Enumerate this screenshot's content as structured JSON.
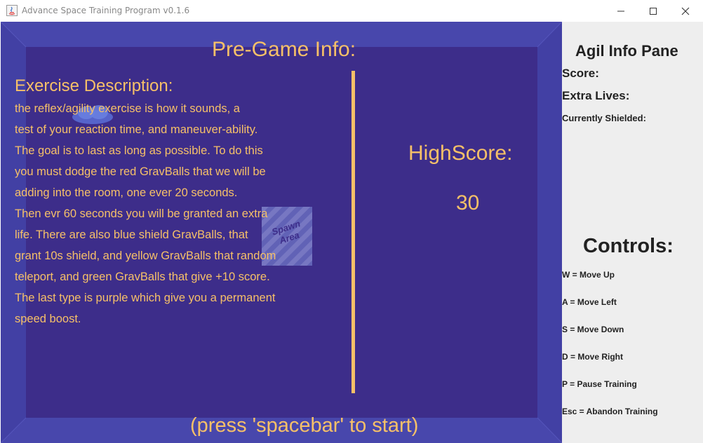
{
  "window": {
    "title": "Advance Space Training Program v0.1.6"
  },
  "game": {
    "pregame_title": "Pre-Game Info:",
    "description_heading": "Exercise Description:",
    "description_lines": [
      "the reflex/agility exercise is how it sounds, a",
      "test of your reaction time, and maneuver-ability.",
      "The goal is to last as long as possible. To do this",
      "you must dodge the red GravBalls that we will be",
      "adding into the room, one ever 20 seconds.",
      "Then evr 60 seconds you will be granted an extra",
      "life. There are also blue shield GravBalls, that",
      "grant 10s shield, and yellow GravBalls that random",
      "teleport, and green GravBalls that give +10 score.",
      "The last type is purple which give you a permanent",
      "speed boost."
    ],
    "highscore_label": "HighScore:",
    "highscore_value": "30",
    "spawn_area_label": "Spawn Area",
    "press_start": "(press 'spacebar' to start)"
  },
  "info_pane": {
    "title": "Agil Info Pane",
    "score_label": "Score:",
    "extra_lives_label": "Extra Lives:",
    "shielded_label": "Currently Shielded:",
    "controls_title": "Controls:",
    "controls": [
      "W = Move Up",
      "A = Move Left",
      "S = Move Down",
      "D = Move Right",
      "P = Pause Training",
      "Esc = Abandon Training"
    ]
  },
  "colors": {
    "room_floor": "#3d2d8a",
    "room_wall": "#4540a6",
    "text_accent": "#f6c068",
    "pane_bg": "#eeeeee"
  }
}
